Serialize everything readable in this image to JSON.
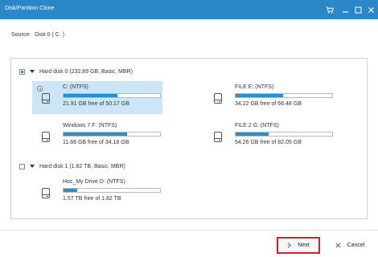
{
  "window": {
    "title": "Disk/Partition Clone",
    "titlebar_color": "#2a88c9",
    "icons": [
      "cart-icon",
      "minimize-icon",
      "maximize-icon",
      "close-icon"
    ]
  },
  "source": {
    "label": "Source:",
    "value": "Disk 0 ( C: )"
  },
  "disks": [
    {
      "label": "Hard disk 0 (232.89 GB, Basic, MBR)",
      "checked": true,
      "partitions": [
        {
          "name": "C: (NTFS)",
          "info": "21.91 GB free of 50.17 GB",
          "selected": true,
          "used_fraction": 0.56
        },
        {
          "name": "FILE E: (NTFS)",
          "info": "34.22 GB free of 66.48 GB",
          "selected": false,
          "used_fraction": 0.49
        },
        {
          "name": "Windows 7 F: (NTFS)",
          "info": "11.68 GB free of 34.18 GB",
          "selected": false,
          "used_fraction": 0.66
        },
        {
          "name": "FILE 2 G: (NTFS)",
          "info": "54.26 GB free of 82.05 GB",
          "selected": false,
          "used_fraction": 0.34
        }
      ]
    },
    {
      "label": "Hard disk 1 (1.82 TB, Basic, MBR)",
      "checked": false,
      "partitions": [
        {
          "name": "Hoc_My Drive D: (NTFS)",
          "info": "1.57 TB free of 1.82 TB",
          "selected": false,
          "used_fraction": 0.14
        }
      ]
    }
  ],
  "footer": {
    "next_label": "Next",
    "cancel_label": "Cancel",
    "next_icon": "chevron-right-icon",
    "cancel_icon": "close-x-icon",
    "highlight_color": "#c92332"
  }
}
